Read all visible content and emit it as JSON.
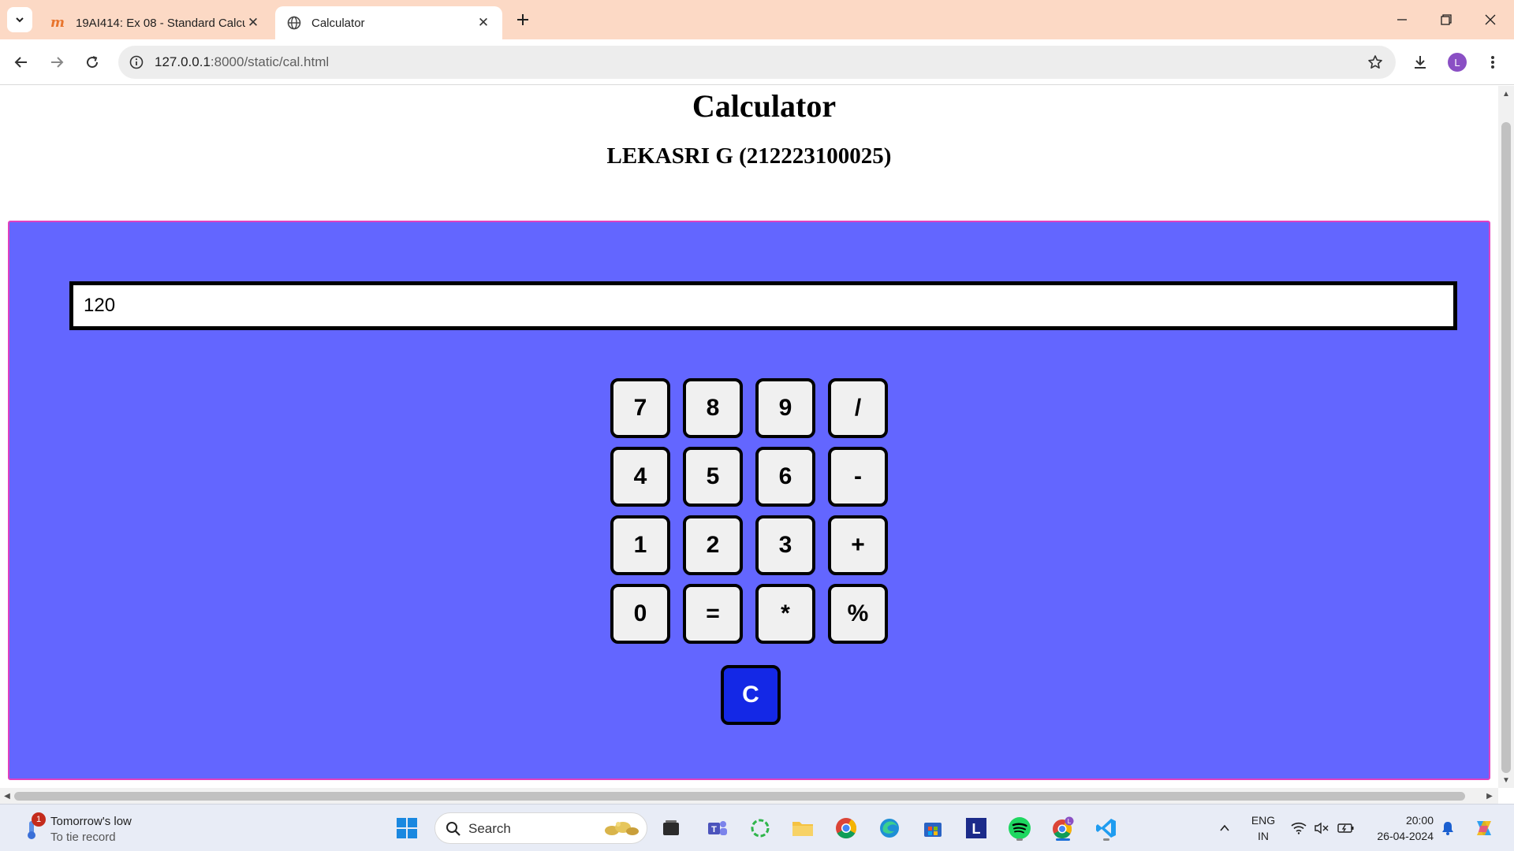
{
  "browser": {
    "tabs": [
      {
        "title": "19AI414: Ex 08 - Standard Calcu",
        "active": false
      },
      {
        "title": "Calculator",
        "active": true
      }
    ],
    "url_host": "127.0.0.1",
    "url_path": ":8000/static/cal.html",
    "profile_initial": "L"
  },
  "page": {
    "title": "Calculator",
    "subtitle": "LEKASRI G (212223100025)",
    "display_value": "120",
    "keys": [
      [
        "7",
        "8",
        "9",
        "/"
      ],
      [
        "4",
        "5",
        "6",
        "-"
      ],
      [
        "1",
        "2",
        "3",
        "+"
      ],
      [
        "0",
        "=",
        "*",
        "%"
      ]
    ],
    "clear_key": "C",
    "panel_color": "#6366ff",
    "clear_key_color": "#1428e6"
  },
  "taskbar": {
    "weather_badge": "1",
    "weather_line1": "Tomorrow's low",
    "weather_line2": "To tie record",
    "search_label": "Search",
    "language_line1": "ENG",
    "language_line2": "IN",
    "time": "20:00",
    "date": "26-04-2024",
    "pinned_icons": [
      "windows-start-icon",
      "search-icon",
      "widgets-icon",
      "task-view-icon",
      "teams-icon",
      "refresh-app-icon",
      "file-explorer-icon",
      "chrome-icon",
      "edge-icon",
      "store-icon",
      "l-app-icon",
      "spotify-icon",
      "chrome-profile-icon",
      "vscode-icon"
    ]
  }
}
